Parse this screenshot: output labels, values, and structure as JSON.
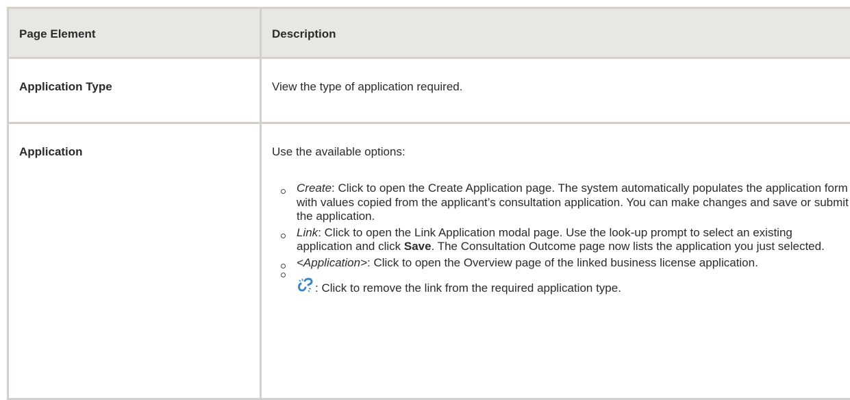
{
  "table": {
    "headers": [
      "Page Element",
      "Description"
    ],
    "rows": [
      {
        "element": "Application Type",
        "description": "View the type of application required."
      },
      {
        "element": "Application",
        "intro": "Use the available options:",
        "options": [
          {
            "term": "Create",
            "text": ": Click to open the Create Application page. The system automatically populates the application form with values copied from the applicant’s consultation application. You can make changes and save or submit the application."
          },
          {
            "term": "Link",
            "text_before": ": Click to open the Link Application modal page. Use the look-up prompt to select an existing application and click ",
            "bold": "Save",
            "text_after": ". The Consultation Outcome page now lists the application you just selected."
          },
          {
            "term": "<Application>",
            "text": ": Click to open the Overview page of the linked business license application."
          },
          {
            "icon": "unlink-icon",
            "text": ": Click to remove the link from the required application type."
          }
        ]
      }
    ]
  }
}
